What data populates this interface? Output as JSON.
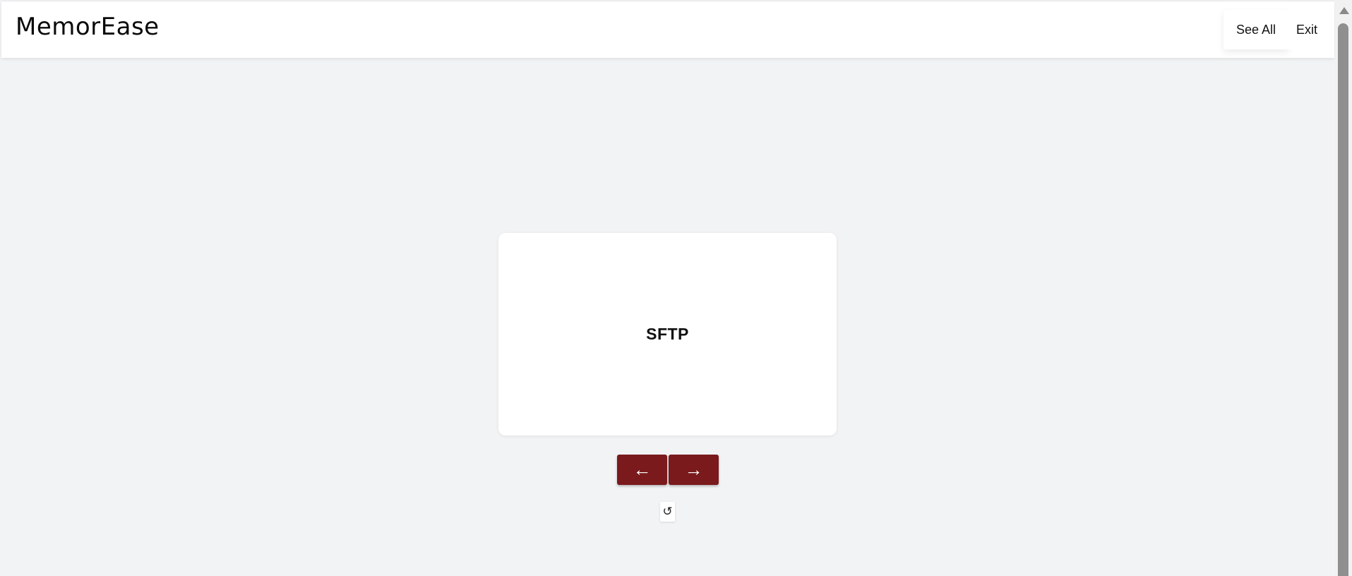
{
  "app": {
    "title": "MemorEase"
  },
  "nav": {
    "see_all_label": "See All",
    "exit_label": "Exit"
  },
  "flashcard": {
    "term": "SFTP"
  },
  "controls": {
    "prev_icon": "←",
    "next_icon": "→",
    "reset_icon": "↺"
  },
  "colors": {
    "accent": "#7a1a1c",
    "background": "#f2f3f5",
    "card": "#ffffff"
  }
}
